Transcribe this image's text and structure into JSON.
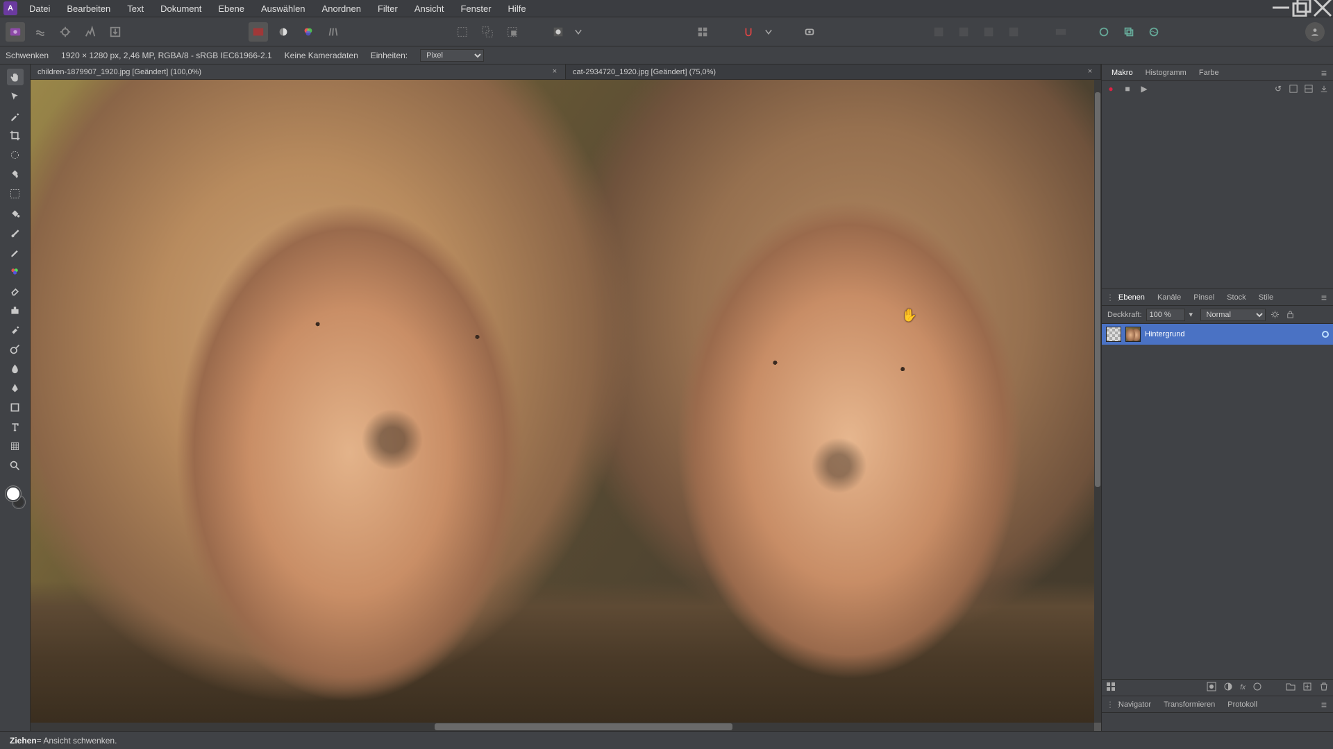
{
  "app_icon_letter": "A",
  "menu": [
    "Datei",
    "Bearbeiten",
    "Text",
    "Dokument",
    "Ebene",
    "Auswählen",
    "Anordnen",
    "Filter",
    "Ansicht",
    "Fenster",
    "Hilfe"
  ],
  "context": {
    "tool": "Schwenken",
    "dims": "1920 × 1280 px, 2,46 MP, RGBA/8 - sRGB IEC61966-2.1",
    "camera": "Keine Kameradaten",
    "units_label": "Einheiten:",
    "unit_value": "Pixel"
  },
  "doc_tabs": [
    {
      "label": "children-1879907_1920.jpg [Geändert] (100,0%)",
      "active": true
    },
    {
      "label": "cat-2934720_1920.jpg [Geändert] (75,0%)",
      "active": false
    }
  ],
  "panel1_tabs": [
    "Makro",
    "Histogramm",
    "Farbe"
  ],
  "panel2_tabs": [
    "Ebenen",
    "Kanäle",
    "Pinsel",
    "Stock",
    "Stile"
  ],
  "panel3_tabs": [
    "Navigator",
    "Transformieren",
    "Protokoll"
  ],
  "layers": {
    "opacity_label": "Deckkraft:",
    "opacity_value": "100 %",
    "blend_value": "Normal",
    "items": [
      {
        "name": "Hintergrund"
      }
    ]
  },
  "status": {
    "verb": "Ziehen",
    "rest": " = Ansicht schwenken."
  },
  "colors": {
    "accent": "#4a72c4"
  }
}
